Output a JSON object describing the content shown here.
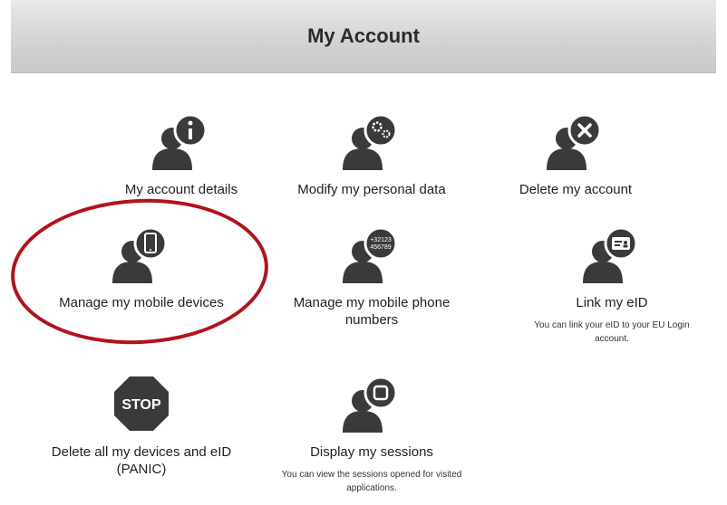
{
  "header": {
    "title": "My Account"
  },
  "tiles": [
    {
      "id": "account-details",
      "label": "My account details",
      "icon": "user-info-icon"
    },
    {
      "id": "modify-personal-data",
      "label": "Modify my personal data",
      "icon": "user-gears-icon"
    },
    {
      "id": "delete-account",
      "label": "Delete my account",
      "icon": "user-delete-icon"
    },
    {
      "id": "manage-mobile-devices",
      "label": "Manage my mobile devices",
      "icon": "user-mobile-icon"
    },
    {
      "id": "manage-phone-numbers",
      "label": "Manage my mobile phone numbers",
      "icon": "user-phone-numbers-icon",
      "badge_text": [
        "+32123",
        "456789"
      ]
    },
    {
      "id": "link-eid",
      "label": "Link my eID",
      "description": "You can link your eID to your EU Login account.",
      "icon": "user-id-card-icon"
    },
    {
      "id": "panic",
      "label": "Delete all my devices and eID (PANIC)",
      "icon": "stop-sign-icon",
      "sign_text": "STOP"
    },
    {
      "id": "sessions",
      "label": "Display my sessions",
      "description": "You can view the sessions opened for visited applications.",
      "icon": "user-sessions-icon"
    }
  ],
  "colors": {
    "icon": "#3a3a3a",
    "highlight": "#b3121a"
  }
}
